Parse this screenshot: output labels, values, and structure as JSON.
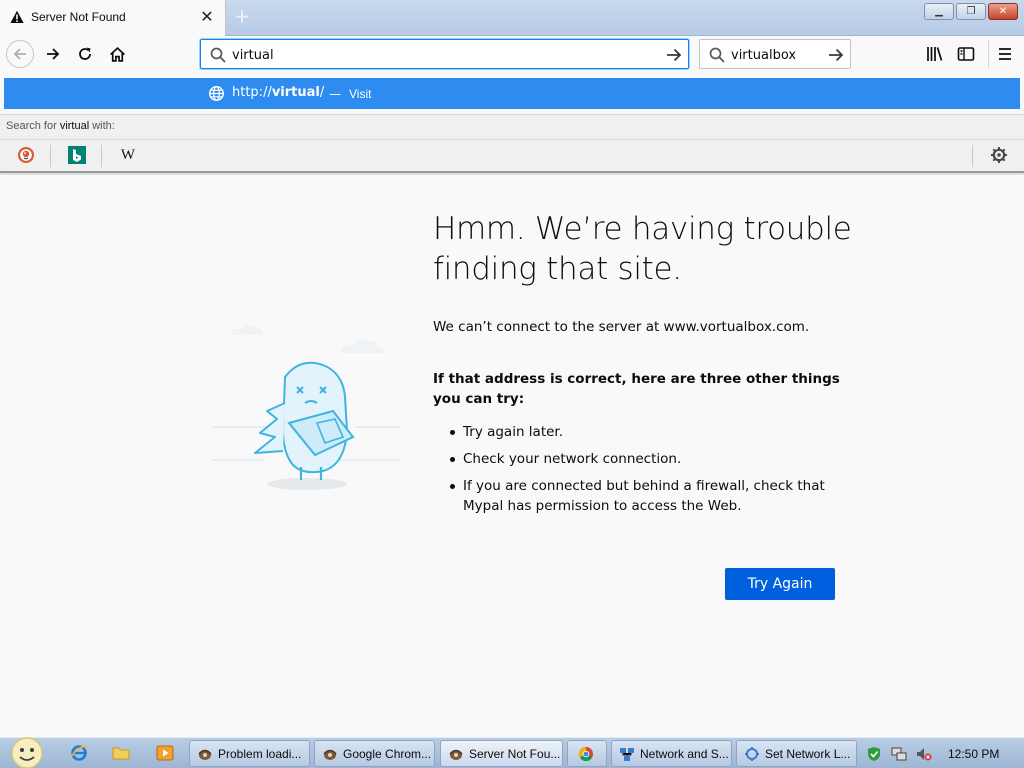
{
  "tab": {
    "title": "Server Not Found",
    "close": "✕",
    "new_tab": "+"
  },
  "window": {
    "minimize": "▁",
    "restore": "❐",
    "close": "✕"
  },
  "nav": {
    "url_value": "virtual",
    "search_value": "virtualbox"
  },
  "autocomplete": {
    "url_prefix": "http://",
    "url_bold": "virtual",
    "url_suffix": "/",
    "separator": "—",
    "action": "Visit",
    "search_for_prefix": "Search for ",
    "search_for_term": "virtual",
    "search_for_suffix": " with:",
    "engines": [
      "duckduckgo-icon",
      "bing-icon",
      "wikipedia-icon"
    ],
    "wikipedia_glyph": "W"
  },
  "error": {
    "title": "Hmm. We’re having trouble finding that site.",
    "description": "We can’t connect to the server at www.vortualbox.com.",
    "try_heading": "If that address is correct, here are three other things you can try:",
    "suggestions": [
      "Try again later.",
      "Check your network connection.",
      "If you are connected but behind a firewall, check that Mypal has permission to access the Web."
    ],
    "try_again_label": "Try Again"
  },
  "taskbar": {
    "tasks": [
      {
        "label": "Problem loadi...",
        "icon": "mypal-icon"
      },
      {
        "label": "Google Chrom...",
        "icon": "mypal-icon"
      },
      {
        "label": "Server Not Fou...",
        "icon": "mypal-icon"
      },
      {
        "label": "",
        "icon": "chrome-icon"
      },
      {
        "label": "Network and S...",
        "icon": "network-icon"
      },
      {
        "label": "Set Network L...",
        "icon": "network-settings-icon"
      }
    ],
    "clock": "12:50 PM"
  },
  "colors": {
    "accent": "#0a84ff",
    "autocomplete_row": "#2e8cf1",
    "button": "#0060df"
  }
}
